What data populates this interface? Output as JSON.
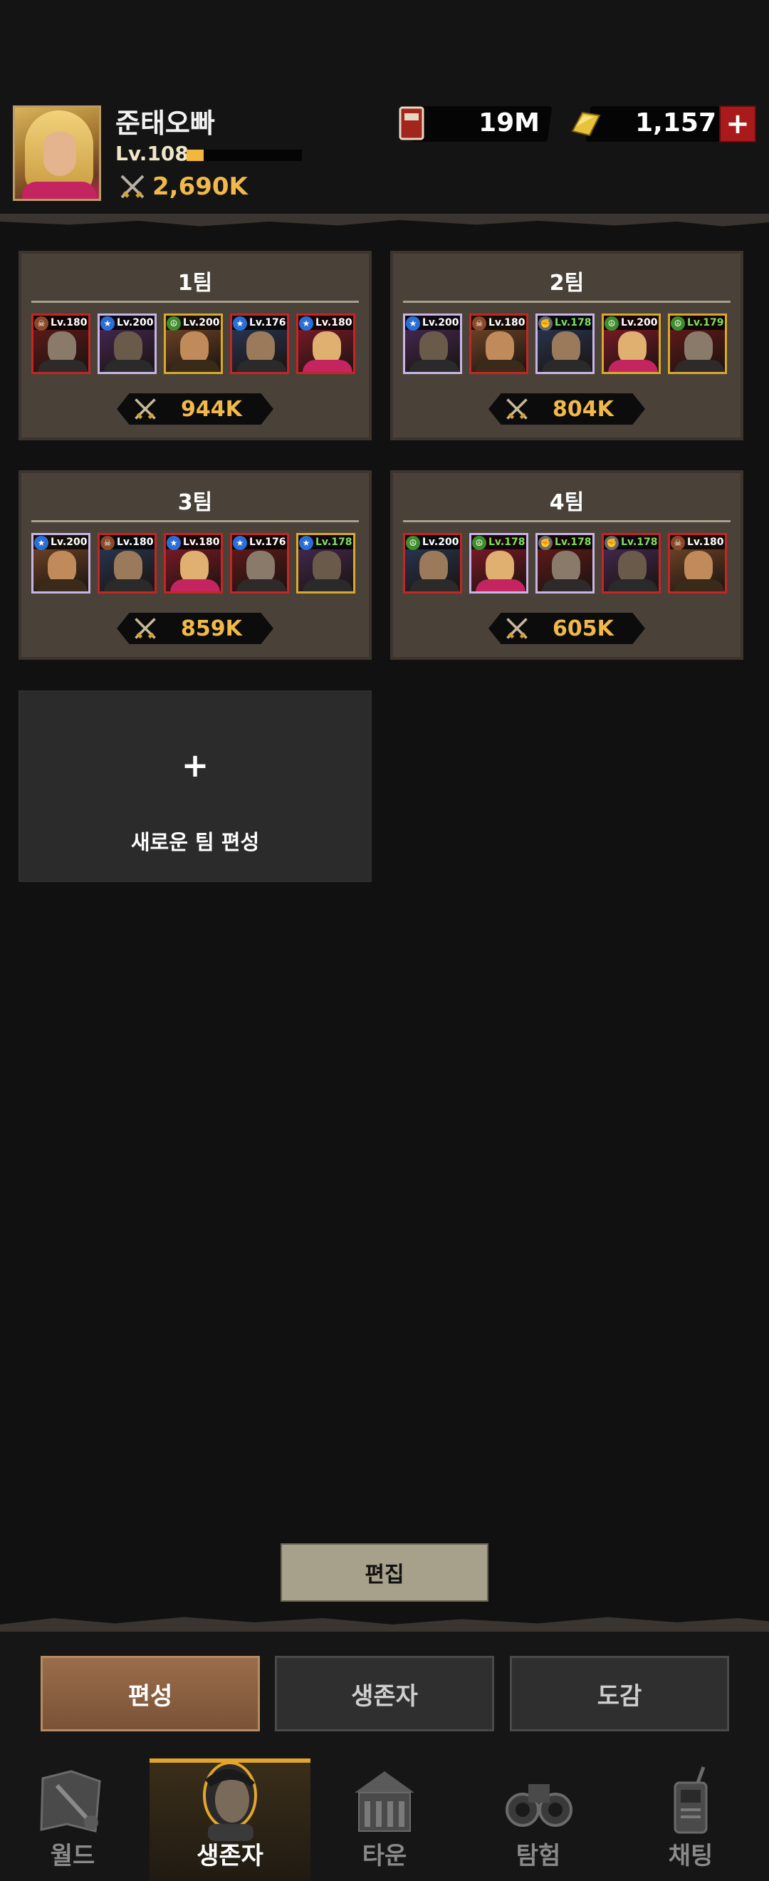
{
  "player": {
    "name": "준태오빠",
    "level": "Lv.108",
    "xp_progress": 0.15,
    "power": "2,690K"
  },
  "currencies": {
    "book": {
      "icon": "book-icon",
      "value": "19M"
    },
    "gold": {
      "icon": "gold-bar-icon",
      "value": "1,157"
    },
    "add_label": "+"
  },
  "teams": [
    {
      "title": "1팀",
      "power": "944K",
      "members": [
        {
          "level": "Lv.180",
          "badge": "skull",
          "frame": "red"
        },
        {
          "level": "Lv.200",
          "badge": "star",
          "frame": "purple"
        },
        {
          "level": "Lv.200",
          "badge": "peace",
          "frame": "gold"
        },
        {
          "level": "Lv.176",
          "badge": "star",
          "frame": "red"
        },
        {
          "level": "Lv.180",
          "badge": "star",
          "frame": "red"
        }
      ]
    },
    {
      "title": "2팀",
      "power": "804K",
      "members": [
        {
          "level": "Lv.200",
          "badge": "star",
          "frame": "purple"
        },
        {
          "level": "Lv.180",
          "badge": "skull",
          "frame": "red"
        },
        {
          "level": "Lv.178",
          "badge": "fist",
          "frame": "purple"
        },
        {
          "level": "Lv.200",
          "badge": "peace",
          "frame": "gold"
        },
        {
          "level": "Lv.179",
          "badge": "peace",
          "frame": "gold"
        }
      ]
    },
    {
      "title": "3팀",
      "power": "859K",
      "members": [
        {
          "level": "Lv.200",
          "badge": "star",
          "frame": "purple"
        },
        {
          "level": "Lv.180",
          "badge": "skull",
          "frame": "red"
        },
        {
          "level": "Lv.180",
          "badge": "star",
          "frame": "red"
        },
        {
          "level": "Lv.176",
          "badge": "star",
          "frame": "red"
        },
        {
          "level": "Lv.178",
          "badge": "star",
          "frame": "gold"
        }
      ]
    },
    {
      "title": "4팀",
      "power": "605K",
      "members": [
        {
          "level": "Lv.200",
          "badge": "peace",
          "frame": "red"
        },
        {
          "level": "Lv.178",
          "badge": "peace",
          "frame": "purple"
        },
        {
          "level": "Lv.178",
          "badge": "fist",
          "frame": "purple"
        },
        {
          "level": "Lv.178",
          "badge": "fist",
          "frame": "red"
        },
        {
          "level": "Lv.180",
          "badge": "skull",
          "frame": "red"
        }
      ]
    }
  ],
  "new_team": {
    "plus": "+",
    "label": "새로운 팀 편성"
  },
  "edit_button": "편집",
  "sub_tabs": [
    "편성",
    "생존자",
    "도감"
  ],
  "nav": [
    "월드",
    "생존자",
    "타운",
    "탐험",
    "채팅"
  ],
  "colors": {
    "accent_gold": "#f1b94a",
    "card_bg": "#4a4238",
    "background": "#111111",
    "active_tab": "#8a5f3f"
  }
}
